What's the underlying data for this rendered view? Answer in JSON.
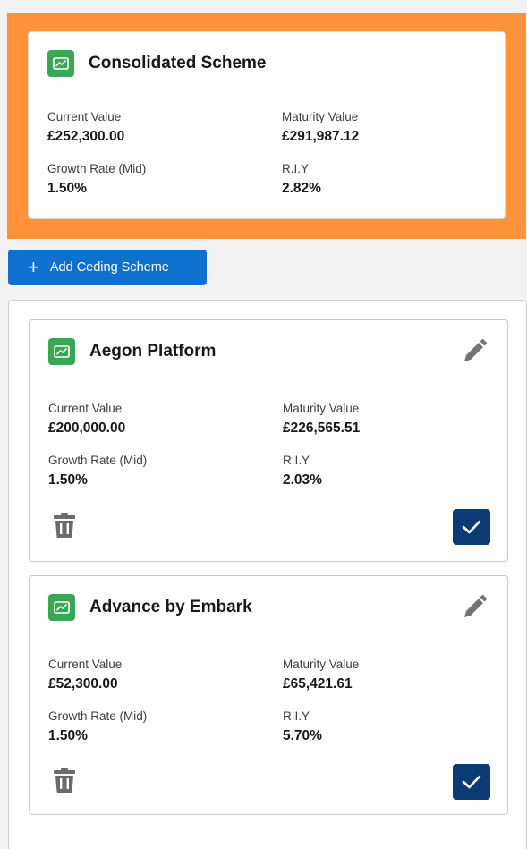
{
  "consolidated": {
    "title": "Consolidated Scheme",
    "current_value_label": "Current Value",
    "current_value": "£252,300.00",
    "maturity_value_label": "Maturity Value",
    "maturity_value": "£291,987.12",
    "growth_rate_label": "Growth Rate (Mid)",
    "growth_rate": "1.50%",
    "riy_label": "R.I.Y",
    "riy": "2.82%"
  },
  "add_button": {
    "label": "Add Ceding Scheme",
    "icon": "plus-icon"
  },
  "ceding_schemes": [
    {
      "title": "Aegon Platform",
      "current_value_label": "Current Value",
      "current_value": "£200,000.00",
      "maturity_value_label": "Maturity Value",
      "maturity_value": "£226,565.51",
      "growth_rate_label": "Growth Rate (Mid)",
      "growth_rate": "1.50%",
      "riy_label": "R.I.Y",
      "riy": "2.03%"
    },
    {
      "title": "Advance by Embark",
      "current_value_label": "Current Value",
      "current_value": "£52,300.00",
      "maturity_value_label": "Maturity Value",
      "maturity_value": "£65,421.61",
      "growth_rate_label": "Growth Rate (Mid)",
      "growth_rate": "1.50%",
      "riy_label": "R.I.Y",
      "riy": "5.70%"
    }
  ],
  "icons": {
    "scheme": "chart-icon",
    "edit": "pencil-icon",
    "delete": "trash-icon",
    "select": "check-icon"
  },
  "colors": {
    "highlight": "#fe9339",
    "icon_green": "#3ba755",
    "primary_button": "#0e70cf",
    "check_button": "#0b3b75"
  }
}
